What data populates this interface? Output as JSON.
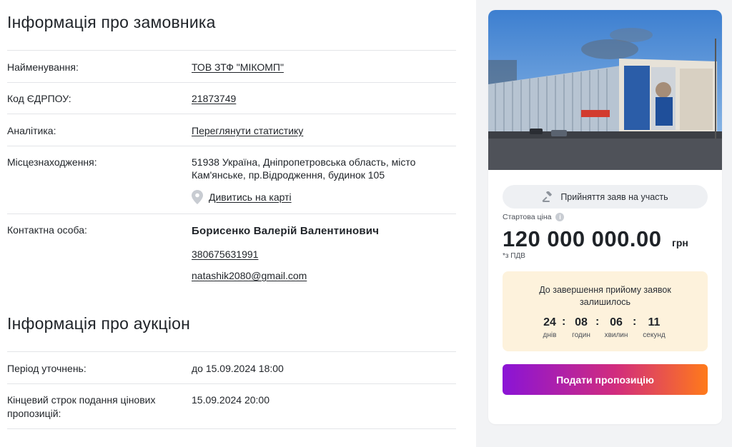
{
  "customer": {
    "title": "Інформація про замовника",
    "rows": [
      {
        "label": "Найменування:",
        "value": "ТОВ ЗТФ \"МІКОМП\""
      },
      {
        "label": "Код ЄДРПОУ:",
        "value": "21873749"
      },
      {
        "label": "Аналітика:",
        "value": "Переглянути статистику"
      },
      {
        "label": "Місцезнаходження:",
        "value_line1": "51938 Україна, Дніпропетровська область, місто",
        "value_line2": "Кам'янське, пр.Відродження, будинок 105",
        "map_link": "Дивитись на карті"
      },
      {
        "label": "Контактна особа:",
        "name": "Борисенко Валерій Валентинович",
        "phone": "380675631991",
        "email": "natashik2080@gmail.com"
      }
    ]
  },
  "auction": {
    "title": "Інформація про аукціон",
    "rows": [
      {
        "label": "Період уточнень:",
        "value": "до 15.09.2024 18:00"
      },
      {
        "label_line1": "Кінцевий строк подання цінових",
        "label_line2": "пропозицій:",
        "value": "15.09.2024 20:00"
      }
    ]
  },
  "card": {
    "status": "Прийняття заяв на участь",
    "start_price_label": "Стартова ціна",
    "price": "120 000 000.00",
    "currency": "грн",
    "vat_note": "*з ПДВ",
    "timer": {
      "title": "До завершення прийому заявок залишилось",
      "days": "24",
      "hours": "08",
      "minutes": "06",
      "seconds": "11",
      "days_label": "днів",
      "hours_label": "годин",
      "minutes_label": "хвилин",
      "seconds_label": "секунд"
    },
    "cta_label": "Подати пропозицію",
    "colors": {
      "gradient_start": "#8a14d6",
      "gradient_mid": "#d12c7e",
      "gradient_end": "#ff7a1a",
      "timer_bg": "#fdf2dc"
    }
  }
}
